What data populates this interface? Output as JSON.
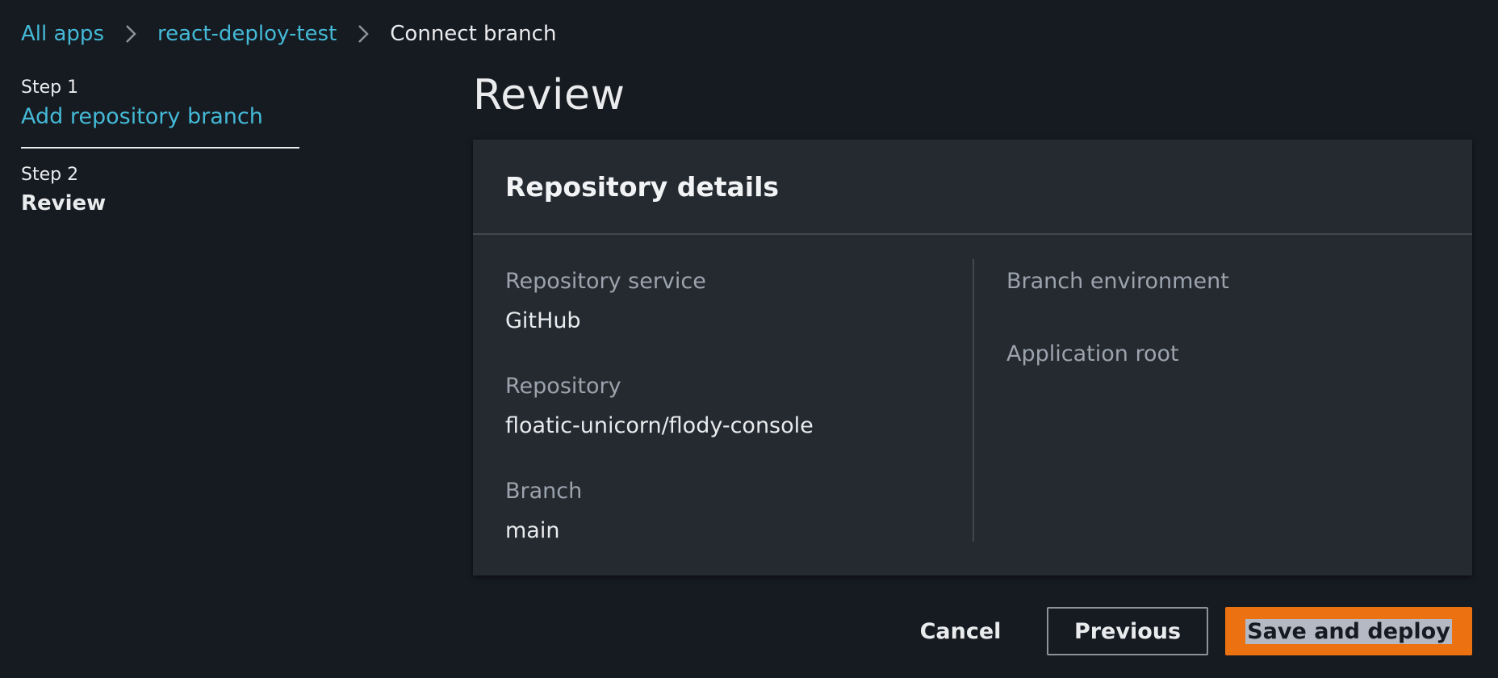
{
  "breadcrumb": {
    "items": [
      {
        "label": "All apps"
      },
      {
        "label": "react-deploy-test"
      }
    ],
    "current": "Connect branch"
  },
  "steps": [
    {
      "number": "Step 1",
      "label": "Add repository branch"
    },
    {
      "number": "Step 2",
      "label": "Review"
    }
  ],
  "page": {
    "title": "Review"
  },
  "panel": {
    "title": "Repository details",
    "left_fields": [
      {
        "label": "Repository service",
        "value": "GitHub"
      },
      {
        "label": "Repository",
        "value": "floatic-unicorn/flody-console"
      },
      {
        "label": "Branch",
        "value": "main"
      }
    ],
    "right_fields": [
      {
        "label": "Branch environment",
        "value": ""
      },
      {
        "label": "Application root",
        "value": ""
      }
    ]
  },
  "actions": {
    "cancel": "Cancel",
    "previous": "Previous",
    "save_deploy": "Save and deploy"
  },
  "colors": {
    "link": "#44b9d6",
    "primary_button": "#ec7211",
    "background": "#161a21",
    "panel": "#252a31"
  },
  "icons": {
    "separator": "chevron-right-icon"
  }
}
